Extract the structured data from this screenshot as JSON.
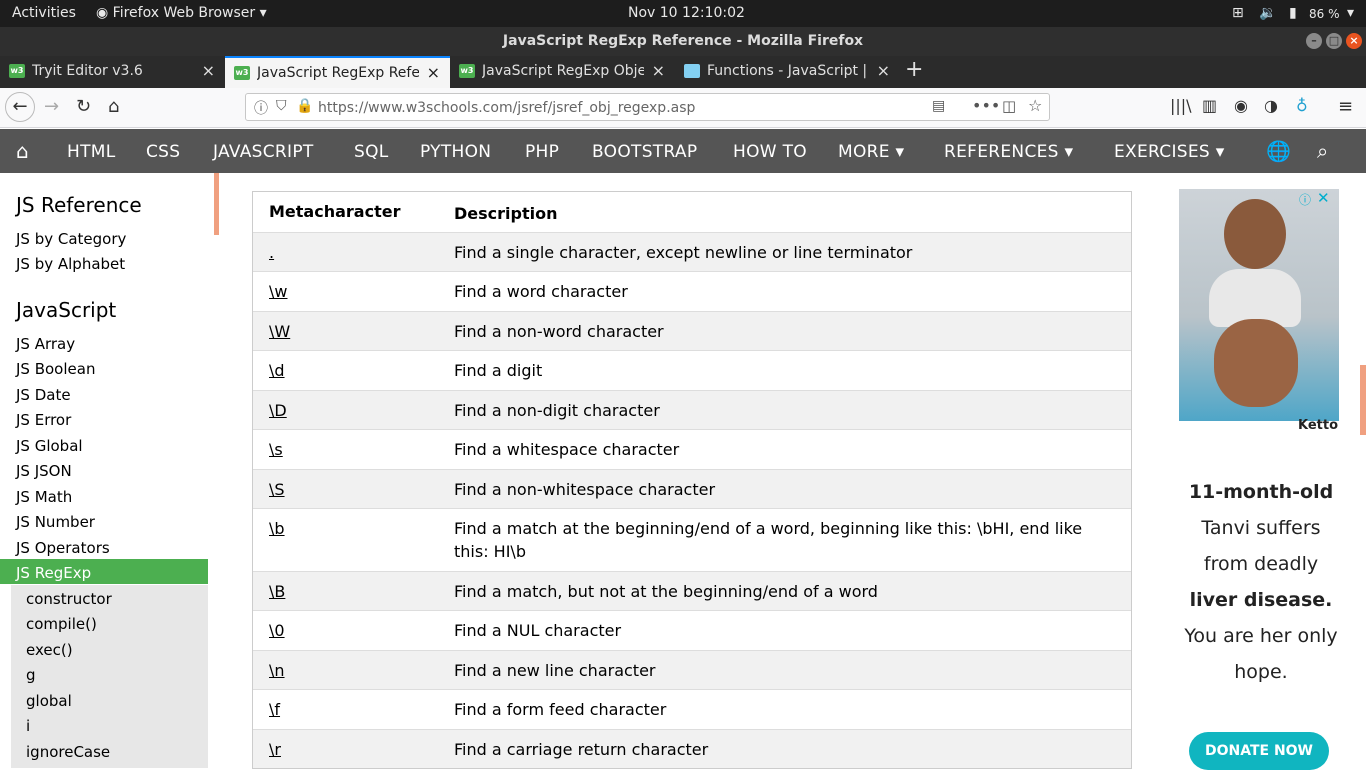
{
  "gnome": {
    "activities": "Activities",
    "app_name": "Firefox Web Browser",
    "clock": "Nov 10  12:10:02",
    "battery": "86 %"
  },
  "window": {
    "title": "JavaScript RegExp Reference - Mozilla Firefox"
  },
  "tabs": [
    {
      "label": "Tryit Editor v3.6",
      "icon": "w3schools-icon"
    },
    {
      "label": "JavaScript RegExp Refer",
      "icon": "w3schools-icon"
    },
    {
      "label": "JavaScript RegExp Obje",
      "icon": "w3schools-icon"
    },
    {
      "label": "Functions - JavaScript | M",
      "icon": "mdn-icon"
    }
  ],
  "url": "https://www.w3schools.com/jsref/jsref_obj_regexp.asp",
  "w3nav": {
    "items": [
      "HTML",
      "CSS",
      "JAVASCRIPT",
      "SQL",
      "PYTHON",
      "PHP",
      "BOOTSTRAP",
      "HOW TO",
      "MORE",
      "REFERENCES",
      "EXERCISES"
    ]
  },
  "sidebar": {
    "heading1": "JS Reference",
    "links1": [
      "JS by Category",
      "JS by Alphabet"
    ],
    "heading2": "JavaScript",
    "links2": [
      "JS Array",
      "JS Boolean",
      "JS Date",
      "JS Error",
      "JS Global",
      "JS JSON",
      "JS Math",
      "JS Number",
      "JS Operators",
      "JS RegExp"
    ],
    "sublinks": [
      "constructor",
      "compile()",
      "exec()",
      "g",
      "global",
      "i",
      "ignoreCase"
    ]
  },
  "table": {
    "headers": [
      "Metacharacter",
      "Description"
    ],
    "rows": [
      [
        ".",
        "Find a single character, except newline or line terminator"
      ],
      [
        "\\w",
        "Find a word character"
      ],
      [
        "\\W",
        "Find a non-word character"
      ],
      [
        "\\d",
        "Find a digit"
      ],
      [
        "\\D",
        "Find a non-digit character"
      ],
      [
        "\\s",
        "Find a whitespace character"
      ],
      [
        "\\S",
        "Find a non-whitespace character"
      ],
      [
        "\\b",
        "Find a match at the beginning/end of a word, beginning like this: \\bHI, end like this: HI\\b"
      ],
      [
        "\\B",
        "Find a match, but not at the beginning/end of a word"
      ],
      [
        "\\0",
        "Find a NUL character"
      ],
      [
        "\\n",
        "Find a new line character"
      ],
      [
        "\\f",
        "Find a form feed character"
      ],
      [
        "\\r",
        "Find a carriage return character"
      ]
    ]
  },
  "ad": {
    "brand": "Ketto",
    "headline": "11-month-old",
    "line2": "Tanvi suffers",
    "line3": "from deadly",
    "line4": "liver disease.",
    "line5": "You are her only",
    "line6": "hope.",
    "cta": "DONATE NOW"
  }
}
